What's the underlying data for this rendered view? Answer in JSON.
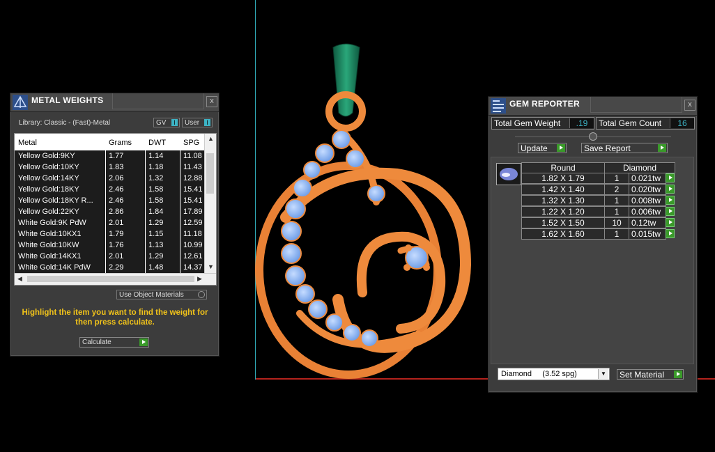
{
  "metal_weights": {
    "title": "METAL WEIGHTS",
    "library_label": "Library: Classic - (Fast)-Metal",
    "toggles": [
      {
        "label": "GV",
        "knob": "I"
      },
      {
        "label": "User",
        "knob": "I"
      }
    ],
    "columns": [
      "Metal",
      "Grams",
      "DWT",
      "SPG"
    ],
    "rows": [
      [
        "Yellow Gold:9KY",
        "1.77",
        "1.14",
        "11.08"
      ],
      [
        "Yellow Gold:10KY",
        "1.83",
        "1.18",
        "11.43"
      ],
      [
        "Yellow Gold:14KY",
        "2.06",
        "1.32",
        "12.88"
      ],
      [
        "Yellow Gold:18KY",
        "2.46",
        "1.58",
        "15.41"
      ],
      [
        "Yellow Gold:18KY R...",
        "2.46",
        "1.58",
        "15.41"
      ],
      [
        "Yellow Gold:22KY",
        "2.86",
        "1.84",
        "17.89"
      ],
      [
        "White Gold:9K PdW",
        "2.01",
        "1.29",
        "12.59"
      ],
      [
        "White Gold:10KX1",
        "1.79",
        "1.15",
        "11.18"
      ],
      [
        "White Gold:10KW",
        "1.76",
        "1.13",
        "10.99"
      ],
      [
        "White Gold:14KX1",
        "2.01",
        "1.29",
        "12.61"
      ],
      [
        "White Gold:14K PdW",
        "2.29",
        "1.48",
        "14.37"
      ]
    ],
    "use_object_materials_label": "Use Object Materials",
    "hint": "Highlight the item you want to find the weight for then press calculate.",
    "calculate_label": "Calculate",
    "close_label": "x"
  },
  "gem_reporter": {
    "title": "GEM REPORTER",
    "total_weight_label": "Total Gem Weight",
    "total_weight_value": ".19",
    "total_count_label": "Total Gem Count",
    "total_count_value": "16",
    "update_label": "Update",
    "save_report_label": "Save Report",
    "table_headers": [
      "Round",
      "Diamond"
    ],
    "rows": [
      {
        "size": "1.82 X 1.79",
        "count": "1",
        "weight": "0.021tw"
      },
      {
        "size": "1.42 X 1.40",
        "count": "2",
        "weight": "0.020tw"
      },
      {
        "size": "1.32 X 1.30",
        "count": "1",
        "weight": "0.008tw"
      },
      {
        "size": "1.22 X 1.20",
        "count": "1",
        "weight": "0.006tw"
      },
      {
        "size": "1.52 X 1.50",
        "count": "10",
        "weight": "0.12tw"
      },
      {
        "size": "1.62 X 1.60",
        "count": "1",
        "weight": "0.015tw"
      }
    ],
    "material_select": "Diamond     (3.52 spg)",
    "set_material_label": "Set Material",
    "close_label": "x"
  },
  "colors": {
    "metal": "#ee8a3c",
    "gem": "#8ab6f0",
    "bail": "#1c7a5a",
    "axis_y": "#2fa8b4",
    "axis_x": "#b4231d",
    "hint_text": "#f0c21a",
    "value_text": "#3db3c4"
  }
}
